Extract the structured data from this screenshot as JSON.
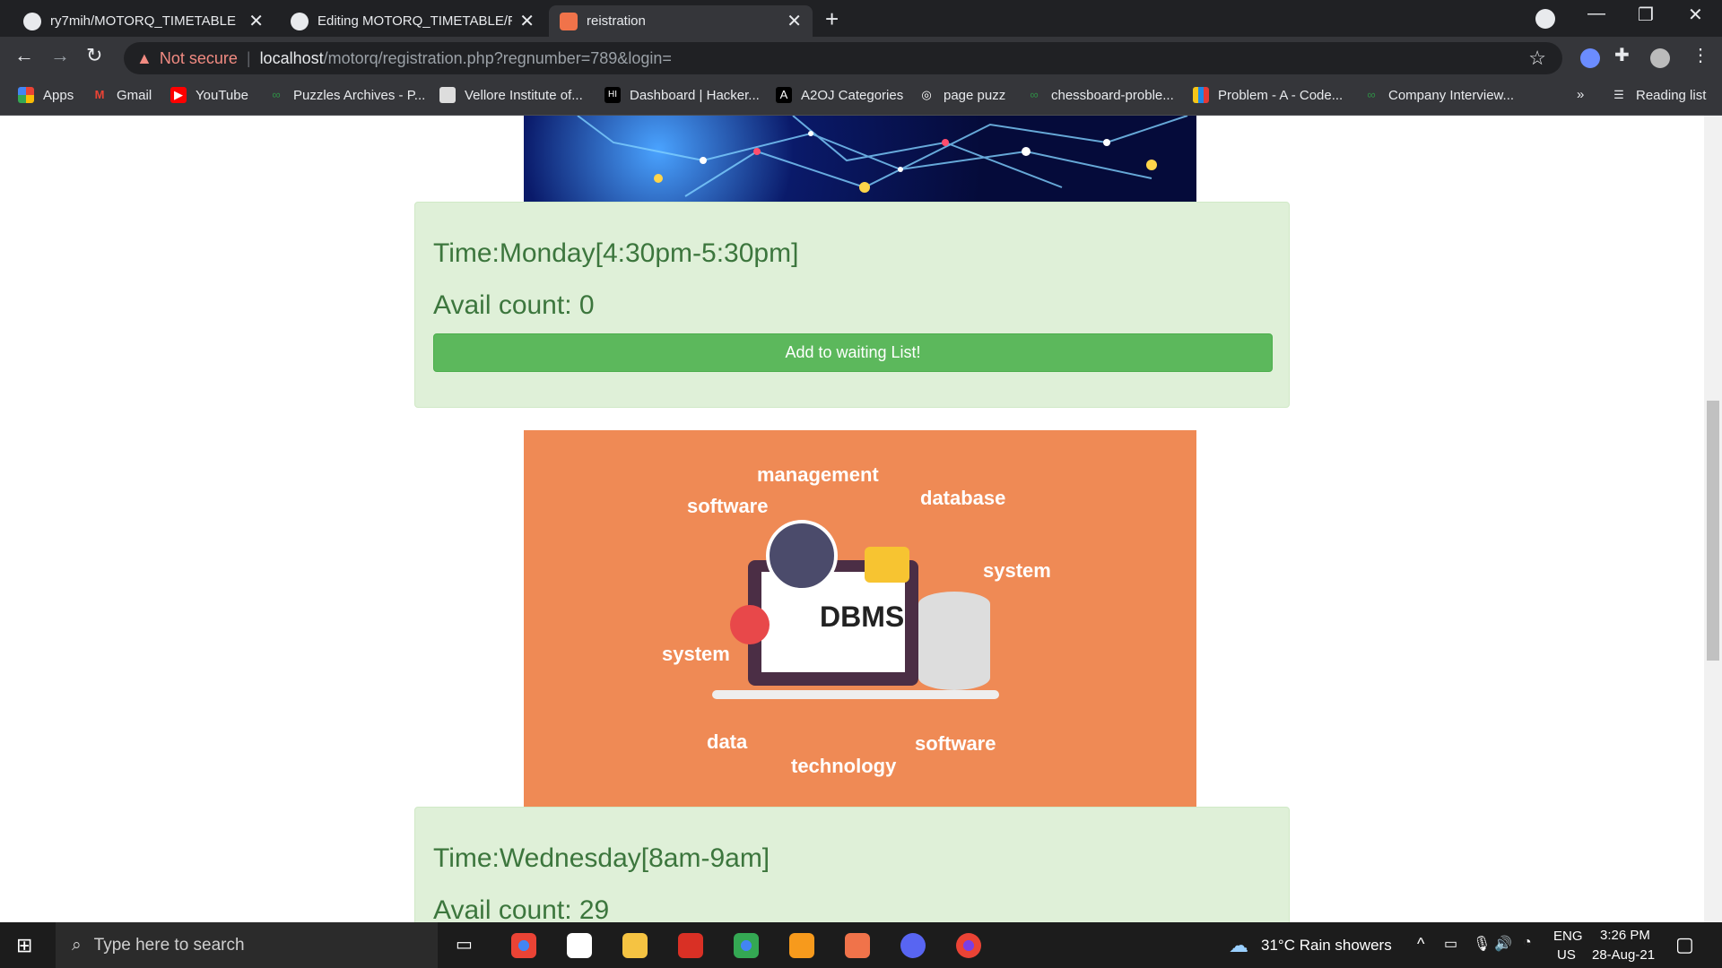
{
  "browser": {
    "tabs": [
      {
        "title": "ry7mih/MOTORQ_TIMETABLE",
        "icon": "github-icon",
        "active": false
      },
      {
        "title": "Editing MOTORQ_TIMETABLE/RE",
        "icon": "github-icon",
        "active": false
      },
      {
        "title": "reistration",
        "icon": "xampp-icon",
        "active": true
      }
    ],
    "address": {
      "warning": "Not secure",
      "host": "localhost",
      "path": "/motorq/registration.php?regnumber=789&login="
    },
    "bookmarks": [
      {
        "label": "Apps",
        "icon": "apps-grid-icon"
      },
      {
        "label": "Gmail",
        "icon": "gmail-icon"
      },
      {
        "label": "YouTube",
        "icon": "youtube-icon"
      },
      {
        "label": "Puzzles Archives - P...",
        "icon": "gfg-icon"
      },
      {
        "label": "Vellore Institute of...",
        "icon": "vit-icon"
      },
      {
        "label": "Dashboard | Hacker...",
        "icon": "hackerrank-icon"
      },
      {
        "label": "A2OJ Categories",
        "icon": "a2oj-icon"
      },
      {
        "label": "page puzz",
        "icon": "globe-icon"
      },
      {
        "label": "chessboard-proble...",
        "icon": "gfg-icon"
      },
      {
        "label": "Problem - A - Code...",
        "icon": "codeforces-icon"
      },
      {
        "label": "Company Interview...",
        "icon": "gfg-icon"
      }
    ],
    "more_bookmarks": "»",
    "reading_list": "Reading list"
  },
  "slots": [
    {
      "time": "Time:Monday[4:30pm-5:30pm]",
      "avail": "Avail count: 0",
      "button": "Add to waiting List!"
    },
    {
      "time": "Time:Wednesday[8am-9am]",
      "avail": "Avail count: 29"
    }
  ],
  "dbms_image": {
    "center": "DBMS",
    "words": [
      "management",
      "software",
      "database",
      "system",
      "system",
      "data",
      "technology",
      "software"
    ]
  },
  "taskbar": {
    "search_placeholder": "Type here to search",
    "weather": "31°C  Rain showers",
    "lang_top": "ENG",
    "lang_bottom": "US",
    "time": "3:26 PM",
    "date": "28-Aug-21"
  },
  "colors": {
    "card_bg": "#dff0d8",
    "card_text": "#3c763d",
    "button_bg": "#5cb85c",
    "dbms_bg": "#ef8a55"
  }
}
